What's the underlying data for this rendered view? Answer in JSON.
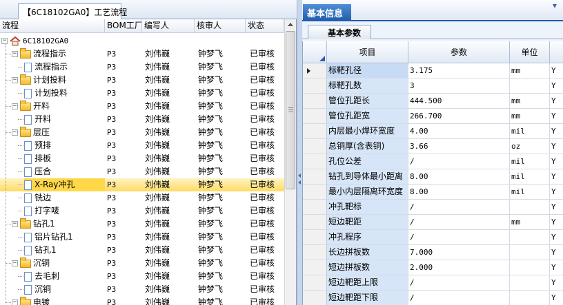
{
  "left_panel": {
    "tab_title": "【6C18102GA0】工艺流程",
    "columns": {
      "process": "流程",
      "bom_factory": "BOM工厂",
      "author": "编写人",
      "reviewer": "核审人",
      "status": "状态"
    },
    "root_label": "6C18102GA0",
    "rows": [
      {
        "name": "流程指示",
        "type": "folder",
        "bom": "P3",
        "author": "刘伟巍",
        "reviewer": "钟梦飞",
        "status": "已审核"
      },
      {
        "name": "流程指示",
        "type": "file",
        "bom": "P3",
        "author": "刘伟巍",
        "reviewer": "钟梦飞",
        "status": "已审核"
      },
      {
        "name": "计划投料",
        "type": "folder",
        "bom": "P3",
        "author": "刘伟巍",
        "reviewer": "钟梦飞",
        "status": "已审核"
      },
      {
        "name": "计划投料",
        "type": "file",
        "bom": "P3",
        "author": "刘伟巍",
        "reviewer": "钟梦飞",
        "status": "已审核"
      },
      {
        "name": "开料",
        "type": "folder",
        "bom": "P3",
        "author": "刘伟巍",
        "reviewer": "钟梦飞",
        "status": "已审核"
      },
      {
        "name": "开料",
        "type": "file",
        "bom": "P3",
        "author": "刘伟巍",
        "reviewer": "钟梦飞",
        "status": "已审核"
      },
      {
        "name": "层压",
        "type": "folder",
        "bom": "P3",
        "author": "刘伟巍",
        "reviewer": "钟梦飞",
        "status": "已审核"
      },
      {
        "name": "预排",
        "type": "file",
        "bom": "P3",
        "author": "刘伟巍",
        "reviewer": "钟梦飞",
        "status": "已审核"
      },
      {
        "name": "排板",
        "type": "file",
        "bom": "P3",
        "author": "刘伟巍",
        "reviewer": "钟梦飞",
        "status": "已审核"
      },
      {
        "name": "压合",
        "type": "file",
        "bom": "P3",
        "author": "刘伟巍",
        "reviewer": "钟梦飞",
        "status": "已审核"
      },
      {
        "name": "X-Ray冲孔",
        "type": "file",
        "bom": "P3",
        "author": "刘伟巍",
        "reviewer": "钟梦飞",
        "status": "已审核",
        "selected": true
      },
      {
        "name": "铣边",
        "type": "file",
        "bom": "P3",
        "author": "刘伟巍",
        "reviewer": "钟梦飞",
        "status": "已审核"
      },
      {
        "name": "打字唛",
        "type": "file",
        "bom": "P3",
        "author": "刘伟巍",
        "reviewer": "钟梦飞",
        "status": "已审核"
      },
      {
        "name": "钻孔1",
        "type": "folder",
        "bom": "P3",
        "author": "刘伟巍",
        "reviewer": "钟梦飞",
        "status": "已审核"
      },
      {
        "name": "铝片钻孔1",
        "type": "file",
        "bom": "P3",
        "author": "刘伟巍",
        "reviewer": "钟梦飞",
        "status": "已审核"
      },
      {
        "name": "钻孔1",
        "type": "file",
        "bom": "P3",
        "author": "刘伟巍",
        "reviewer": "钟梦飞",
        "status": "已审核"
      },
      {
        "name": "沉铜",
        "type": "folder",
        "bom": "P3",
        "author": "刘伟巍",
        "reviewer": "钟梦飞",
        "status": "已审核"
      },
      {
        "name": "去毛刺",
        "type": "file",
        "bom": "P3",
        "author": "刘伟巍",
        "reviewer": "钟梦飞",
        "status": "已审核"
      },
      {
        "name": "沉铜",
        "type": "file",
        "bom": "P3",
        "author": "刘伟巍",
        "reviewer": "钟梦飞",
        "status": "已审核"
      },
      {
        "name": "电镀",
        "type": "folder",
        "bom": "P3",
        "author": "刘伟巍",
        "reviewer": "钟梦飞",
        "status": "已审核"
      }
    ]
  },
  "right_panel": {
    "main_tab": "基本信息",
    "sub_tab": "基本参数",
    "columns": {
      "item": "项目",
      "param": "参数",
      "unit": "单位"
    },
    "rows": [
      {
        "item": "标靶孔径",
        "param": "3.175",
        "unit": "mm",
        "flag": "Y"
      },
      {
        "item": "标靶孔数",
        "param": "3",
        "unit": "",
        "flag": "Y"
      },
      {
        "item": "管位孔距长",
        "param": "444.500",
        "unit": "mm",
        "flag": "Y"
      },
      {
        "item": "管位孔距宽",
        "param": "266.700",
        "unit": "mm",
        "flag": "Y"
      },
      {
        "item": "内层最小焊环宽度",
        "param": "4.00",
        "unit": "mil",
        "flag": "Y"
      },
      {
        "item": "总铜厚(含表铜)",
        "param": "3.66",
        "unit": "oz",
        "flag": "Y"
      },
      {
        "item": "孔位公差",
        "param": "/",
        "unit": "mil",
        "flag": "Y"
      },
      {
        "item": "钻孔到导体最小距离",
        "param": "8.00",
        "unit": "mil",
        "flag": "Y"
      },
      {
        "item": "最小内层隔离环宽度",
        "param": "8.00",
        "unit": "mil",
        "flag": "Y"
      },
      {
        "item": "冲孔靶标",
        "param": "/",
        "unit": "",
        "flag": "Y"
      },
      {
        "item": "短边靶距",
        "param": "/",
        "unit": "mm",
        "flag": "Y"
      },
      {
        "item": "冲孔程序",
        "param": "/",
        "unit": "",
        "flag": "Y"
      },
      {
        "item": "长边拼板数",
        "param": "7.000",
        "unit": "",
        "flag": "Y"
      },
      {
        "item": "短边拼板数",
        "param": "2.000",
        "unit": "",
        "flag": "Y"
      },
      {
        "item": "短边靶距上限",
        "param": "/",
        "unit": "",
        "flag": "Y"
      },
      {
        "item": "短边靶距下限",
        "param": "/",
        "unit": "",
        "flag": "Y"
      }
    ]
  }
}
